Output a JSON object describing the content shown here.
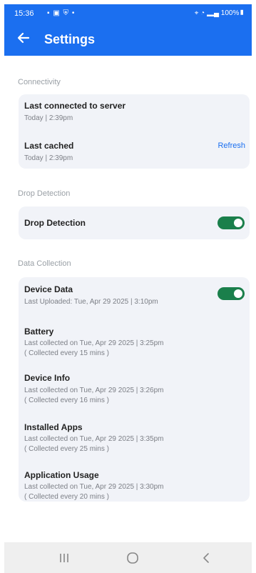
{
  "status_bar": {
    "time": "15:36",
    "left_icons": "▪ ▣ ⛨ •",
    "right_text": "⌖ ◔ ▂▄ 100%▮"
  },
  "header": {
    "title": "Settings"
  },
  "connectivity": {
    "label": "Connectivity",
    "last_connected_title": "Last connected to server",
    "last_connected_value": "Today | 2:39pm",
    "last_cached_title": "Last cached",
    "last_cached_value": "Today | 2:39pm",
    "refresh_label": "Refresh"
  },
  "drop_detection": {
    "label": "Drop Detection",
    "toggle_title": "Drop Detection",
    "enabled": true
  },
  "data_collection": {
    "label": "Data Collection",
    "device_data": {
      "title": "Device Data",
      "subtitle": "Last Uploaded: Tue, Apr 29 2025 | 3:10pm",
      "enabled": true
    },
    "items": [
      {
        "title": "Battery",
        "line1": "Last collected on Tue, Apr 29 2025 | 3:25pm",
        "line2": "( Collected every 15 mins )"
      },
      {
        "title": "Device Info",
        "line1": "Last collected on Tue, Apr 29 2025 | 3:26pm",
        "line2": "( Collected every 16 mins )"
      },
      {
        "title": "Installed Apps",
        "line1": "Last collected on Tue, Apr 29 2025 | 3:35pm",
        "line2": "( Collected every 25 mins )"
      },
      {
        "title": "Application Usage",
        "line1": "Last collected on Tue, Apr 29 2025 | 3:30pm",
        "line2": "( Collected every 20 mins )"
      }
    ]
  },
  "colors": {
    "accent": "#1b6ff0",
    "toggle_on": "#1a7f4b",
    "card_bg": "#f1f3f8"
  }
}
